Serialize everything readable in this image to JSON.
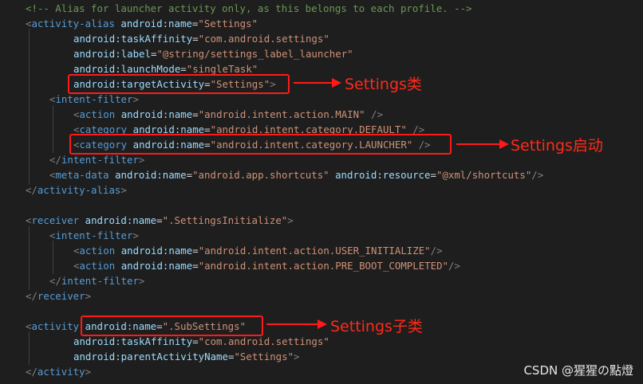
{
  "lines": [
    {
      "indent": 32,
      "segs": [
        {
          "t": "<!-- Alias for launcher activity only, as this belongs to each profile. -->",
          "c": "c-comment"
        }
      ]
    },
    {
      "indent": 32,
      "segs": [
        {
          "t": "<",
          "c": "c-pun"
        },
        {
          "t": "activity-alias",
          "c": "c-tag"
        },
        {
          "t": " android:name",
          "c": "c-attr"
        },
        {
          "t": "=",
          "c": "c-txt"
        },
        {
          "t": "\"Settings\"",
          "c": "c-val"
        }
      ]
    },
    {
      "indent": 92,
      "segs": [
        {
          "t": "android:taskAffinity",
          "c": "c-attr"
        },
        {
          "t": "=",
          "c": "c-txt"
        },
        {
          "t": "\"com.android.settings\"",
          "c": "c-val"
        }
      ]
    },
    {
      "indent": 92,
      "segs": [
        {
          "t": "android:label",
          "c": "c-attr"
        },
        {
          "t": "=",
          "c": "c-txt"
        },
        {
          "t": "\"@string/settings_label_launcher\"",
          "c": "c-val"
        }
      ]
    },
    {
      "indent": 92,
      "segs": [
        {
          "t": "android:launchMode",
          "c": "c-attr"
        },
        {
          "t": "=",
          "c": "c-txt"
        },
        {
          "t": "\"singleTask\"",
          "c": "c-val"
        }
      ]
    },
    {
      "indent": 92,
      "segs": [
        {
          "t": "android:targetActivity",
          "c": "c-attr"
        },
        {
          "t": "=",
          "c": "c-txt"
        },
        {
          "t": "\"Settings\"",
          "c": "c-val"
        },
        {
          "t": ">",
          "c": "c-pun"
        }
      ]
    },
    {
      "indent": 62,
      "segs": [
        {
          "t": "<",
          "c": "c-pun"
        },
        {
          "t": "intent-filter",
          "c": "c-tag"
        },
        {
          "t": ">",
          "c": "c-pun"
        }
      ]
    },
    {
      "indent": 92,
      "segs": [
        {
          "t": "<",
          "c": "c-pun"
        },
        {
          "t": "action",
          "c": "c-tag"
        },
        {
          "t": " android:name",
          "c": "c-attr"
        },
        {
          "t": "=",
          "c": "c-txt"
        },
        {
          "t": "\"android.intent.action.MAIN\"",
          "c": "c-val"
        },
        {
          "t": " />",
          "c": "c-pun"
        }
      ]
    },
    {
      "indent": 92,
      "segs": [
        {
          "t": "<",
          "c": "c-pun"
        },
        {
          "t": "category",
          "c": "c-tag"
        },
        {
          "t": " android:name",
          "c": "c-attr"
        },
        {
          "t": "=",
          "c": "c-txt"
        },
        {
          "t": "\"android.intent.category.DEFAULT\"",
          "c": "c-val"
        },
        {
          "t": " />",
          "c": "c-pun"
        }
      ]
    },
    {
      "indent": 92,
      "segs": [
        {
          "t": "<",
          "c": "c-pun"
        },
        {
          "t": "category",
          "c": "c-tag"
        },
        {
          "t": " android:name",
          "c": "c-attr"
        },
        {
          "t": "=",
          "c": "c-txt"
        },
        {
          "t": "\"android.intent.category.LAUNCHER\"",
          "c": "c-val"
        },
        {
          "t": " />",
          "c": "c-pun"
        }
      ]
    },
    {
      "indent": 62,
      "segs": [
        {
          "t": "</",
          "c": "c-pun"
        },
        {
          "t": "intent-filter",
          "c": "c-tag"
        },
        {
          "t": ">",
          "c": "c-pun"
        }
      ]
    },
    {
      "indent": 62,
      "segs": [
        {
          "t": "<",
          "c": "c-pun"
        },
        {
          "t": "meta-data",
          "c": "c-tag"
        },
        {
          "t": " android:name",
          "c": "c-attr"
        },
        {
          "t": "=",
          "c": "c-txt"
        },
        {
          "t": "\"android.app.shortcuts\"",
          "c": "c-val"
        },
        {
          "t": " android:resource",
          "c": "c-attr"
        },
        {
          "t": "=",
          "c": "c-txt"
        },
        {
          "t": "\"@xml/shortcuts\"",
          "c": "c-val"
        },
        {
          "t": "/>",
          "c": "c-pun"
        }
      ]
    },
    {
      "indent": 32,
      "segs": [
        {
          "t": "</",
          "c": "c-pun"
        },
        {
          "t": "activity-alias",
          "c": "c-tag"
        },
        {
          "t": ">",
          "c": "c-pun"
        }
      ]
    },
    {
      "indent": 32,
      "segs": []
    },
    {
      "indent": 32,
      "segs": [
        {
          "t": "<",
          "c": "c-pun"
        },
        {
          "t": "receiver",
          "c": "c-tag"
        },
        {
          "t": " android:name",
          "c": "c-attr"
        },
        {
          "t": "=",
          "c": "c-txt"
        },
        {
          "t": "\".SettingsInitialize\"",
          "c": "c-val"
        },
        {
          "t": ">",
          "c": "c-pun"
        }
      ]
    },
    {
      "indent": 62,
      "segs": [
        {
          "t": "<",
          "c": "c-pun"
        },
        {
          "t": "intent-filter",
          "c": "c-tag"
        },
        {
          "t": ">",
          "c": "c-pun"
        }
      ]
    },
    {
      "indent": 92,
      "segs": [
        {
          "t": "<",
          "c": "c-pun"
        },
        {
          "t": "action",
          "c": "c-tag"
        },
        {
          "t": " android:name",
          "c": "c-attr"
        },
        {
          "t": "=",
          "c": "c-txt"
        },
        {
          "t": "\"android.intent.action.USER_INITIALIZE\"",
          "c": "c-val"
        },
        {
          "t": "/>",
          "c": "c-pun"
        }
      ]
    },
    {
      "indent": 92,
      "segs": [
        {
          "t": "<",
          "c": "c-pun"
        },
        {
          "t": "action",
          "c": "c-tag"
        },
        {
          "t": " android:name",
          "c": "c-attr"
        },
        {
          "t": "=",
          "c": "c-txt"
        },
        {
          "t": "\"android.intent.action.PRE_BOOT_COMPLETED\"",
          "c": "c-val"
        },
        {
          "t": "/>",
          "c": "c-pun"
        }
      ]
    },
    {
      "indent": 62,
      "segs": [
        {
          "t": "</",
          "c": "c-pun"
        },
        {
          "t": "intent-filter",
          "c": "c-tag"
        },
        {
          "t": ">",
          "c": "c-pun"
        }
      ]
    },
    {
      "indent": 32,
      "segs": [
        {
          "t": "</",
          "c": "c-pun"
        },
        {
          "t": "receiver",
          "c": "c-tag"
        },
        {
          "t": ">",
          "c": "c-pun"
        }
      ]
    },
    {
      "indent": 32,
      "segs": []
    },
    {
      "indent": 32,
      "segs": [
        {
          "t": "<",
          "c": "c-pun"
        },
        {
          "t": "activity",
          "c": "c-tag"
        },
        {
          "t": " android:name",
          "c": "c-attr"
        },
        {
          "t": "=",
          "c": "c-txt"
        },
        {
          "t": "\".SubSettings\"",
          "c": "c-val"
        }
      ]
    },
    {
      "indent": 92,
      "segs": [
        {
          "t": "android:taskAffinity",
          "c": "c-attr"
        },
        {
          "t": "=",
          "c": "c-txt"
        },
        {
          "t": "\"com.android.settings\"",
          "c": "c-val"
        }
      ]
    },
    {
      "indent": 92,
      "segs": [
        {
          "t": "android:parentActivityName",
          "c": "c-attr"
        },
        {
          "t": "=",
          "c": "c-txt"
        },
        {
          "t": "\"Settings\"",
          "c": "c-val"
        },
        {
          "t": ">",
          "c": "c-pun"
        }
      ]
    },
    {
      "indent": 32,
      "segs": [
        {
          "t": "</",
          "c": "c-pun"
        },
        {
          "t": "activity",
          "c": "c-tag"
        },
        {
          "t": ">",
          "c": "c-pun"
        }
      ]
    }
  ],
  "annotations": {
    "target_activity": "Settings类",
    "launcher": "Settings启动",
    "sub_settings": "Settings子类"
  },
  "watermark": "CSDN @猩猩の點燈",
  "colors": {
    "highlight": "#ff1a1a",
    "background": "#1e1e1e"
  }
}
